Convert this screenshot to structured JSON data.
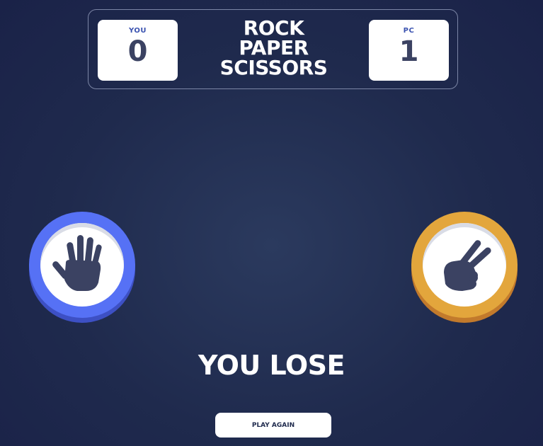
{
  "title": {
    "line1": "ROCK",
    "line2": "PAPER",
    "line3": "SCISSORS"
  },
  "score": {
    "you_label": "YOU",
    "you_value": "0",
    "pc_label": "PC",
    "pc_value": "1"
  },
  "picks": {
    "player": "paper",
    "house": "scissors"
  },
  "colors": {
    "paper": "#5671f5",
    "scissors": "#e3a63c",
    "background": "#1f2a4d"
  },
  "icons": {
    "player": "paper-hand-icon",
    "house": "scissors-hand-icon"
  },
  "result": {
    "text": "YOU LOSE"
  },
  "actions": {
    "play_again_label": "PLAY AGAIN"
  }
}
